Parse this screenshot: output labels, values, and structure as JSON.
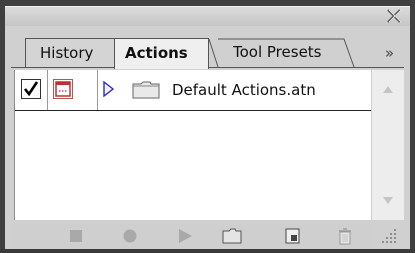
{
  "panel": {
    "tabs": [
      {
        "label": "History",
        "active": false
      },
      {
        "label": "Actions",
        "active": true
      },
      {
        "label": "Tool Presets",
        "active": false
      }
    ],
    "overflow_glyph": "»",
    "close_icon": "close-icon"
  },
  "actions": {
    "rows": [
      {
        "included": true,
        "dialog_toggle": true,
        "expanded": false,
        "icon": "folder-icon",
        "label": "Default Actions.atn"
      }
    ]
  },
  "toolbar": {
    "buttons": [
      {
        "name": "stop-button",
        "icon": "stop-icon"
      },
      {
        "name": "record-button",
        "icon": "record-icon"
      },
      {
        "name": "play-button",
        "icon": "play-icon"
      },
      {
        "name": "new-set-button",
        "icon": "folder-icon"
      },
      {
        "name": "new-action-button",
        "icon": "new-page-icon"
      },
      {
        "name": "delete-button",
        "icon": "trash-icon"
      }
    ]
  },
  "colors": {
    "panel_bg": "#d0d0d0",
    "list_bg": "#ffffff",
    "expander": "#2a2ae0",
    "dialog_icon": "#c03030"
  }
}
